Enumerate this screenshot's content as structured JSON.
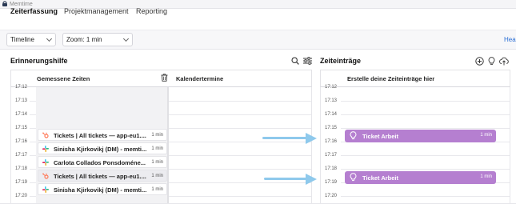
{
  "window": {
    "title": "Memtime"
  },
  "nav": {
    "tabs": [
      "Zeiterfassung",
      "Projektmanagement",
      "Reporting"
    ],
    "active": "Zeiterfassung"
  },
  "toolbar": {
    "view_select": "Timeline",
    "zoom_select": "Zoom: 1 min",
    "help_link": "Hea"
  },
  "left_panel": {
    "title": "Erinnerungshilfe",
    "col_measured": "Gemessene Zeiten",
    "col_calendar": "Kalendertermine",
    "times": [
      "17:12",
      "17:13",
      "17:14",
      "17:15",
      "17:16",
      "17:17",
      "17:18",
      "17:19",
      "17:20"
    ],
    "entries": [
      {
        "app": "hubspot",
        "text": "Tickets | All tickets — app-eu1....",
        "duration": "1 min",
        "active": false
      },
      {
        "app": "slack",
        "text": "Sinisha Kjirkovikj (DM) - memti...",
        "duration": "1 min",
        "active": false
      },
      {
        "app": "slack",
        "text": "Carlota Collados Ponsdoméne...",
        "duration": "1 min",
        "active": false
      },
      {
        "app": "hubspot",
        "text": "Tickets | All tickets — app-eu1....",
        "duration": "1 min",
        "active": true
      },
      {
        "app": "slack",
        "text": "Sinisha Kjirkovikj (DM) - memti...",
        "duration": "1 min",
        "active": false
      }
    ]
  },
  "right_panel": {
    "title": "Zeiteinträge",
    "header": "Erstelle deine Zeiteinträge hier",
    "times": [
      "17:12",
      "17:13",
      "17:14",
      "17:15",
      "17:16",
      "17:17",
      "17:18",
      "17:19",
      "17:20"
    ],
    "tickets": [
      {
        "label": "Ticket Arbeit",
        "duration": "1 min"
      },
      {
        "label": "Ticket Arbeit",
        "duration": "1 min"
      }
    ]
  },
  "colors": {
    "accent": "#b57fd0",
    "arrow": "#8ec9ec",
    "link": "#2a6fd6",
    "hubspot": "#ff7a59"
  },
  "icons": [
    "app-icon",
    "search-icon",
    "filter-icon",
    "trash-icon",
    "add-icon",
    "bulb-icon",
    "upload-icon",
    "hubspot-icon",
    "slack-icon"
  ]
}
